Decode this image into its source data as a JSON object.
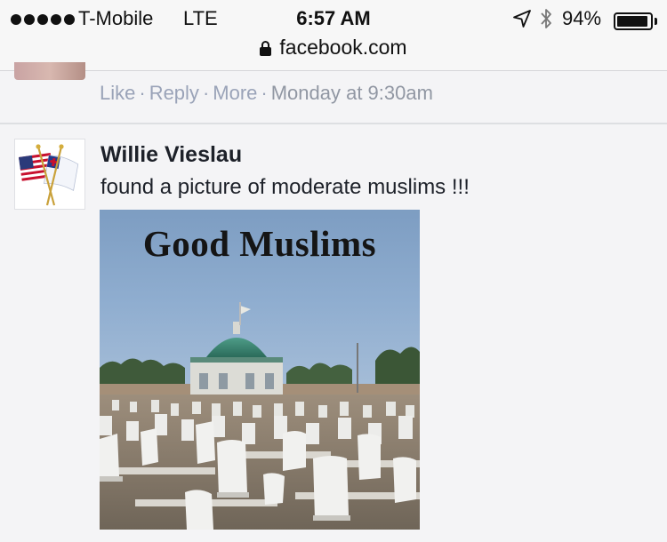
{
  "status_bar": {
    "carrier": "T-Mobile",
    "network": "LTE",
    "time": "6:57 AM",
    "battery_percent_label": "94%",
    "battery_level": 0.94,
    "icons": [
      "location-arrow-icon",
      "bluetooth-icon",
      "battery-icon"
    ]
  },
  "url_bar": {
    "url": "facebook.com",
    "icon": "lock-icon"
  },
  "previous_comment": {
    "actions": {
      "like": "Like",
      "reply": "Reply",
      "more": "More",
      "timestamp": "Monday at 9:30am"
    }
  },
  "comment": {
    "author": "Willie Vieslau",
    "text": "found a picture of moderate muslims !!!",
    "attachment": {
      "caption": "Good Muslims",
      "scene": "cemetery with white headstones and a green-domed mosque"
    }
  },
  "colors": {
    "meta_text": "#9197a3",
    "link_text": "#9aa3b8",
    "author_text": "#1d2129",
    "background": "#f4f4f6"
  }
}
